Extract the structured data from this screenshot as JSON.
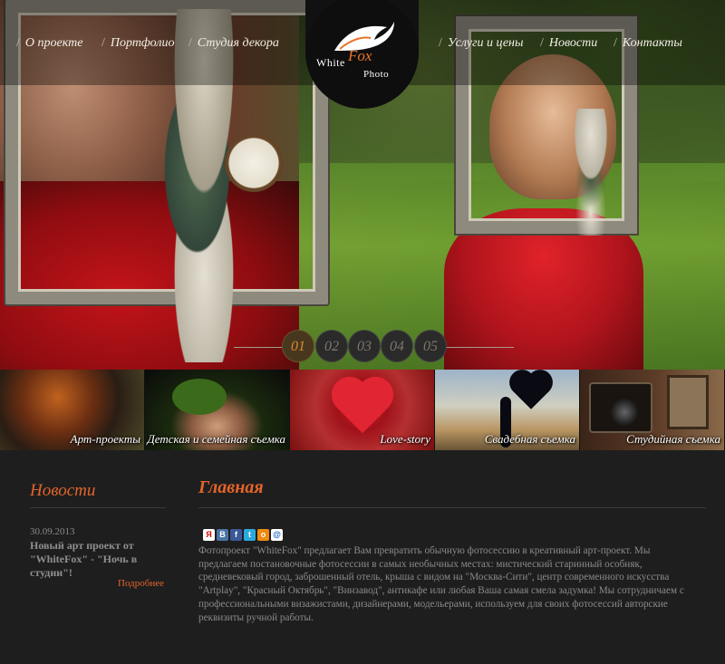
{
  "nav": {
    "left": [
      "О проекте",
      "Портфолио",
      "Студия декора"
    ],
    "right": [
      "Услуги и цены",
      "Новости",
      "Контакты"
    ],
    "separator": "/"
  },
  "logo": {
    "white": "White",
    "fox": "Fox",
    "photo": "Photo"
  },
  "slider": {
    "pages": [
      "01",
      "02",
      "03",
      "04",
      "05"
    ],
    "active_index": 0
  },
  "categories": [
    "Арт-проекты",
    "Детская и семейная съемка",
    "Love-story",
    "Свадебная съемка",
    "Студийная съемка"
  ],
  "news": {
    "title": "Новости",
    "date": "30.09.2013",
    "headline": "Новый арт проект от \"WhiteFox\" - \"Ночь в студии\"!",
    "more": "Подробнее"
  },
  "main": {
    "title": "Главная",
    "share_icons": [
      "yandex-icon",
      "vk-icon",
      "facebook-icon",
      "twitter-icon",
      "odnoklassniki-icon",
      "mail-icon"
    ],
    "text": "Фотопроект \"WhiteFox\" предлагает Вам превратить обычную фотосессию в креативный арт-проект. Мы предлагаем постановочные фотосессии в самых необычных местах: мистический старинный особняк, средневековый город, заброшенный отель, крыша с видом на \"Москва-Сити\", центр современного искусства \"Artplay\", \"Красный Октябрь\", \"Винзавод\", антикафе или любая Ваша самая смела задумка! Мы сотрудничаем с профессиональными визажистами, дизайнерами, модельерами, используем для своих фотосессий авторские реквизиты ручной работы."
  },
  "colors": {
    "accent": "#e3642a",
    "background": "#1e1e1e",
    "text": "#8a8a8a"
  }
}
